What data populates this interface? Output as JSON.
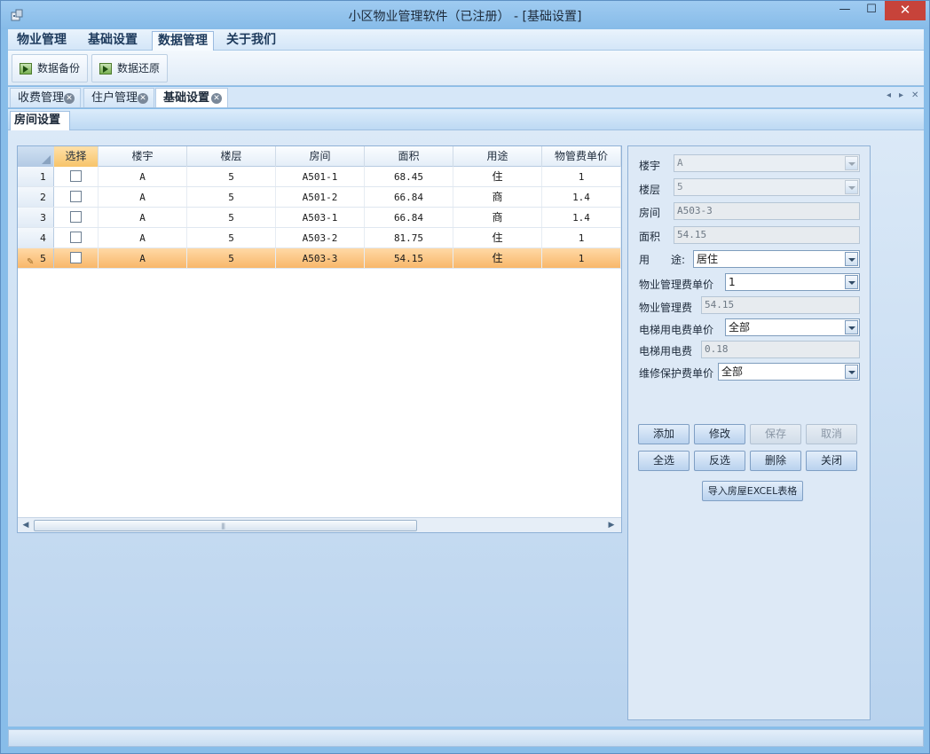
{
  "window": {
    "title": "小区物业管理软件（已注册） - [基础设置]",
    "min": "—",
    "max": "☐",
    "close": "✕"
  },
  "menu": {
    "items": [
      "物业管理",
      "基础设置",
      "数据管理",
      "关于我们"
    ],
    "active": "数据管理"
  },
  "ribbon": {
    "backup": "数据备份",
    "restore": "数据还原"
  },
  "doc_tabs": {
    "items": [
      "收费管理",
      "住户管理",
      "基础设置"
    ],
    "active": "基础设置",
    "nav_left": "◂",
    "nav_right": "▸",
    "nav_close": "✕",
    "tab_close": "✕"
  },
  "sub_tab": "房间设置",
  "grid": {
    "columns": [
      "选择",
      "楼宇",
      "楼层",
      "房间",
      "面积",
      "用途",
      "物管费单价"
    ],
    "rows": [
      {
        "num": "1",
        "building": "A",
        "floor": "5",
        "room": "A501-1",
        "area": "68.45",
        "use": "住",
        "price": "1"
      },
      {
        "num": "2",
        "building": "A",
        "floor": "5",
        "room": "A501-2",
        "area": "66.84",
        "use": "商",
        "price": "1.4"
      },
      {
        "num": "3",
        "building": "A",
        "floor": "5",
        "room": "A503-1",
        "area": "66.84",
        "use": "商",
        "price": "1.4"
      },
      {
        "num": "4",
        "building": "A",
        "floor": "5",
        "room": "A503-2",
        "area": "81.75",
        "use": "住",
        "price": "1"
      },
      {
        "num": "5",
        "building": "A",
        "floor": "5",
        "room": "A503-3",
        "area": "54.15",
        "use": "住",
        "price": "1"
      }
    ],
    "selected_row": 5,
    "edit_mark": "✎",
    "scroll_left": "◀",
    "scroll_right": "▶",
    "scroll_grip": "|||"
  },
  "form": {
    "building_label": "楼宇",
    "building_value": "A",
    "floor_label": "楼层",
    "floor_value": "5",
    "room_label": "房间",
    "room_value": "A503-3",
    "area_label": "面积",
    "area_value": "54.15",
    "use_label": "用　　途:",
    "use_value": "居住",
    "mgmt_price_label": "物业管理费单价",
    "mgmt_price_value": "1",
    "mgmt_fee_label": "物业管理费",
    "mgmt_fee_value": "54.15",
    "elev_price_label": "电梯用电费单价",
    "elev_price_value": "全部",
    "elev_fee_label": "电梯用电费",
    "elev_fee_value": "0.18",
    "repair_price_label": "维修保护费单价",
    "repair_price_value": "全部"
  },
  "buttons": {
    "add": "添加",
    "edit": "修改",
    "save": "保存",
    "cancel": "取消",
    "select_all": "全选",
    "invert": "反选",
    "delete": "删除",
    "close": "关闭",
    "import_excel": "导入房屋EXCEL表格"
  }
}
